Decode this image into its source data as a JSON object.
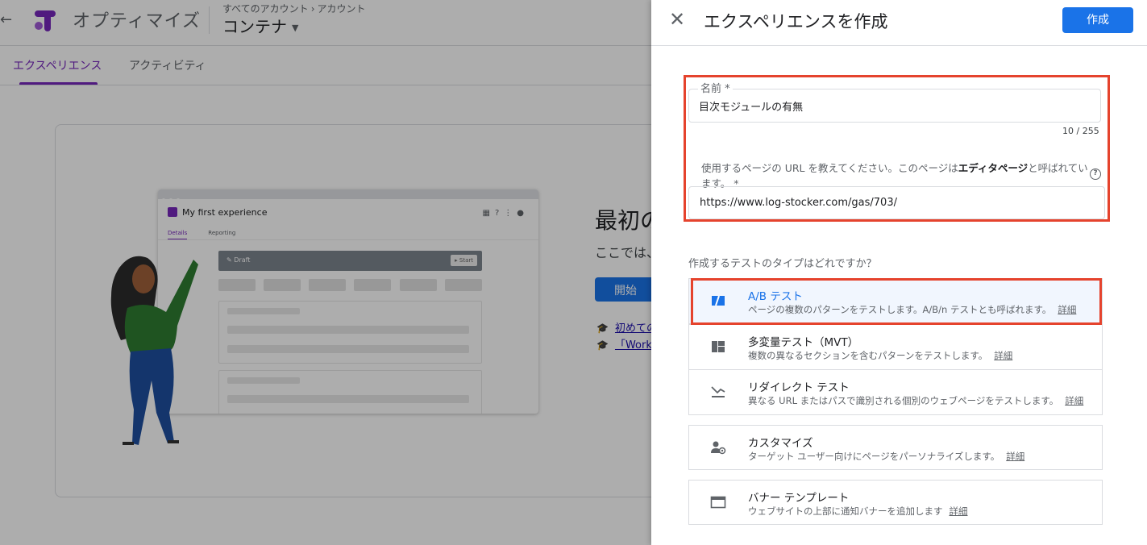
{
  "app": {
    "product_name": "オプティマイズ",
    "breadcrumb": [
      "すべてのアカウント",
      "アカウント"
    ],
    "breadcrumb_sep": "›",
    "container_name": "コンテナ",
    "tabs": [
      {
        "label": "エクスペリエンス",
        "active": true
      },
      {
        "label": "アクティビティ",
        "active": false
      }
    ],
    "welcome": {
      "title": "最初の",
      "subtitle": "ここでは、",
      "start_label": "開始",
      "links": [
        "初めての",
        "「Work"
      ]
    },
    "mock": {
      "title": "My first experience",
      "tabs": [
        "Details",
        "Reporting"
      ],
      "draft_label": "Draft",
      "start_label": "▸ Start"
    }
  },
  "panel": {
    "title": "エクスペリエンスを作成",
    "create_label": "作成",
    "name_field": {
      "label": "名前 *",
      "value": "目次モジュールの有無",
      "counter": "10 / 255"
    },
    "url_field": {
      "label_prefix": "使用するページの URL を教えてください。このページは",
      "label_bold": "エディタページ",
      "label_suffix": "と呼ばれています。 *",
      "value": "https://www.log-stocker.com/gas/703/"
    },
    "type_question": "作成するテストのタイプはどれですか？",
    "detail_label": "詳細",
    "types": [
      {
        "name": "A/B テスト",
        "desc": "ページの複数のパターンをテストします。A/B/n テストとも呼ばれます。",
        "icon": "ab-test-icon",
        "selected": true
      },
      {
        "name": "多変量テスト（MVT）",
        "desc": "複数の異なるセクションを含むパターンをテストします。",
        "icon": "mvt-icon",
        "selected": false
      },
      {
        "name": "リダイレクト テスト",
        "desc": "異なる URL またはパスで識別される個別のウェブページをテストします。",
        "icon": "redirect-icon",
        "selected": false
      },
      {
        "name": "カスタマイズ",
        "desc": "ターゲット ユーザー向けにページをパーソナライズします。",
        "icon": "personalize-icon",
        "selected": false
      },
      {
        "name": "バナー テンプレート",
        "desc": "ウェブサイトの上部に通知バナーを追加します",
        "icon": "banner-icon",
        "selected": false
      }
    ]
  },
  "colors": {
    "accent": "#1a73e8",
    "brand": "#7627bb",
    "highlight": "#e5432d"
  }
}
